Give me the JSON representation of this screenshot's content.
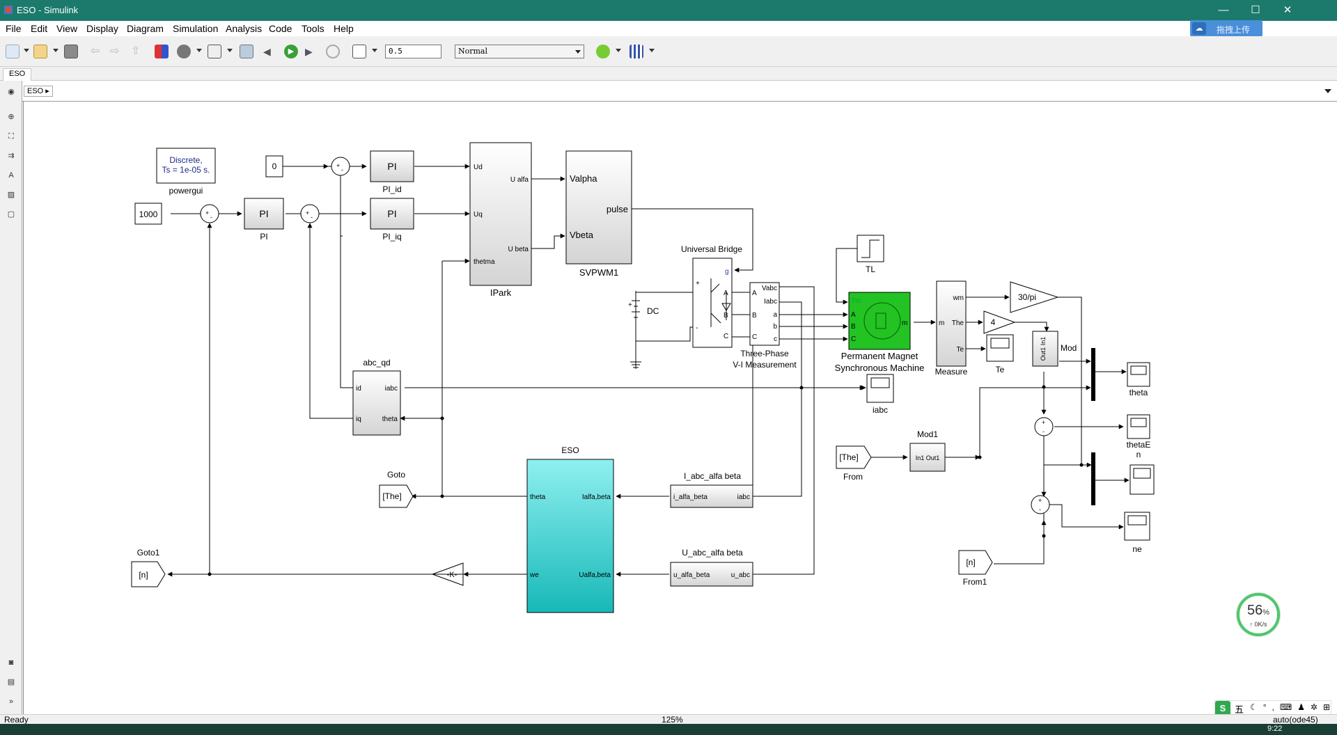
{
  "window": {
    "title": "ESO - Simulink",
    "min": "—",
    "max": "☐",
    "close": "✕"
  },
  "menu": [
    "File",
    "Edit",
    "View",
    "Display",
    "Diagram",
    "Simulation",
    "Analysis",
    "Code",
    "Tools",
    "Help"
  ],
  "baidu": {
    "label": "拖拽上传",
    "icon": "cloud-upload-icon"
  },
  "toolbar": {
    "stop_time": "0.5",
    "sim_mode": "Normal"
  },
  "tab": {
    "label": "ESO"
  },
  "breadcrumb": {
    "label": "ESO"
  },
  "blocks": {
    "powergui": {
      "line1": "Discrete,",
      "line2": "Ts = 1e-05 s.",
      "name": "powergui"
    },
    "const1000": "1000",
    "const0": "0",
    "pi_main": {
      "text": "PI",
      "name": "PI"
    },
    "pi_id": {
      "text": "PI",
      "name": "PI_id"
    },
    "pi_iq": {
      "text": "PI",
      "name": "PI_iq"
    },
    "ipark": {
      "name": "IPark",
      "ud": "Ud",
      "uq": "Uq",
      "thetma": "thetma",
      "ualfa": "U alfa",
      "ubeta": "U beta"
    },
    "svpwm": {
      "name": "SVPWM1",
      "valpha": "Valpha",
      "vbeta": "Vbeta",
      "pulse": "pulse"
    },
    "bridge": {
      "name": "Universal Bridge",
      "g": "g",
      "a": "A",
      "b": "B",
      "c": "C",
      "plus": "+",
      "minus": "-"
    },
    "dc": {
      "name": "DC",
      "plus": "+"
    },
    "vim": {
      "name1": "Three-Phase",
      "name2": "V-I Measurement",
      "vabc": "Vabc",
      "iabc": "Iabc",
      "A": "A",
      "B": "B",
      "C": "C",
      "a": "a",
      "b": "b",
      "c": "c"
    },
    "tl": "TL",
    "pmsm": {
      "name1": "Permanent Magnet",
      "name2": "Synchronous Machine",
      "tm": "Tm",
      "A": "A",
      "B": "B",
      "C": "C",
      "m": "m"
    },
    "measure": {
      "name": "Measure",
      "wm": "wm",
      "the": "The",
      "te": "Te",
      "m": "m"
    },
    "gain30pi": "30/pi",
    "gain4": "4",
    "mod": {
      "name": "Mod",
      "port": "Out1 In1"
    },
    "scopes": {
      "te": "Te",
      "iabc": "iabc",
      "theta": "theta",
      "thetaEn1": "thetaE",
      "thetaEn2": "n",
      "ne": "ne"
    },
    "abc_qd": {
      "name": "abc_qd",
      "id": "id",
      "iq": "iq",
      "iabc": "iabc",
      "theta": "theta"
    },
    "from_the": {
      "tag": "[The]",
      "name": "From"
    },
    "mod1": {
      "name": "Mod1",
      "port": "In1 Out1"
    },
    "goto": {
      "tag": "[The]",
      "name": "Goto"
    },
    "eso": {
      "name": "ESO",
      "theta": "theta",
      "we": "we",
      "ialfa": "Ialfa,beta",
      "ualfa": "Ualfa,beta"
    },
    "i_abc": {
      "name": "I_abc_alfa beta",
      "left": "i_alfa_beta",
      "right": "iabc"
    },
    "u_abc": {
      "name": "U_abc_alfa beta",
      "left": "u_alfa_beta",
      "right": "u_abc"
    },
    "goto1": {
      "tag": "[n]",
      "name": "Goto1"
    },
    "gainK": "-K-",
    "from1": {
      "tag": "[n]",
      "name": "From1"
    },
    "sum_plus": "+",
    "sum_minus": "-"
  },
  "status": {
    "left": "Ready",
    "zoom": "125%",
    "solver": "auto(ode45)"
  },
  "network": {
    "percent": "56",
    "unit": "%",
    "speed": "0K/s"
  },
  "ime": {
    "mode": "五"
  },
  "clock": "9:22"
}
